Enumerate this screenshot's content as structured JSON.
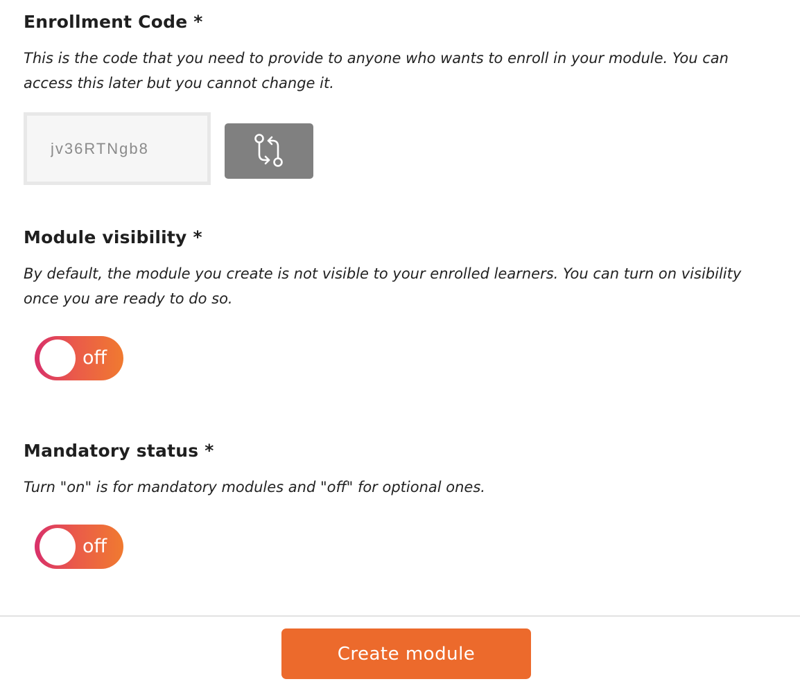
{
  "enrollment": {
    "title": "Enrollment Code *",
    "description": "This is the code that you need to provide to anyone who wants to enroll in your module. You can access this later but you cannot change it.",
    "code_value": "jv36RTNgb8",
    "regenerate_icon": "git-compare-icon"
  },
  "visibility": {
    "title": "Module visibility *",
    "description": "By default, the module you create is not visible to your enrolled learners. You can turn on visibility once you are ready to do so.",
    "toggle_label": "off",
    "toggle_state": false
  },
  "mandatory": {
    "title": "Mandatory status *",
    "description": "Turn \"on\" is for mandatory modules and \"off\" for optional ones.",
    "toggle_label": "off",
    "toggle_state": false
  },
  "footer": {
    "create_label": "Create module"
  },
  "colors": {
    "toggle_gradient_start": "#d8306a",
    "toggle_gradient_end": "#f07a30",
    "primary_button": "#ec6a2c",
    "regenerate_button": "#808080"
  }
}
